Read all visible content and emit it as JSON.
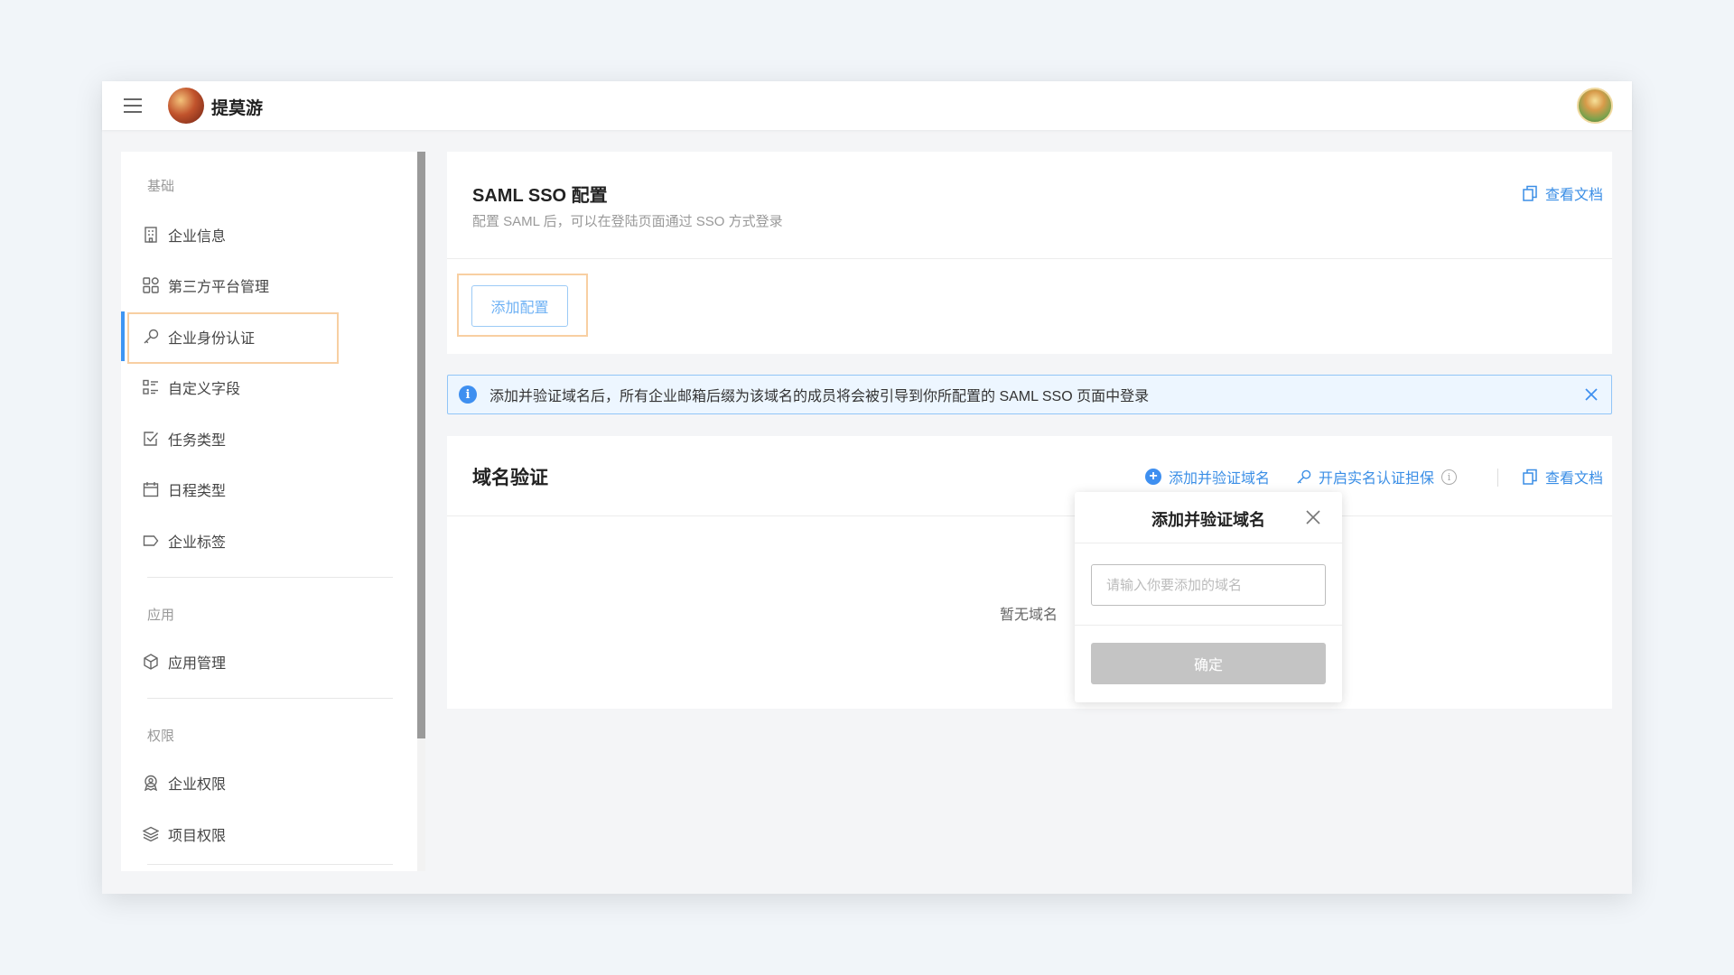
{
  "header": {
    "brand": "提莫游",
    "menu_icon": "hamburger-icon",
    "logo": "brand-logo",
    "avatar": "user-avatar"
  },
  "sidebar": {
    "groups": [
      {
        "title": "基础",
        "items": [
          {
            "label": "企业信息",
            "icon": "building-icon"
          },
          {
            "label": "第三方平台管理",
            "icon": "grid-icon"
          },
          {
            "label": "企业身份认证",
            "icon": "key-icon",
            "active": true
          },
          {
            "label": "自定义字段",
            "icon": "list-icon"
          },
          {
            "label": "任务类型",
            "icon": "checkbox-icon"
          },
          {
            "label": "日程类型",
            "icon": "calendar-icon"
          },
          {
            "label": "企业标签",
            "icon": "tag-icon"
          }
        ]
      },
      {
        "title": "应用",
        "items": [
          {
            "label": "应用管理",
            "icon": "cube-icon"
          }
        ]
      },
      {
        "title": "权限",
        "items": [
          {
            "label": "企业权限",
            "icon": "badge-icon"
          },
          {
            "label": "项目权限",
            "icon": "layers-icon"
          }
        ]
      }
    ]
  },
  "saml": {
    "title": "SAML SSO 配置",
    "subtitle": "配置 SAML 后，可以在登陆页面通过 SSO 方式登录",
    "doc_link": "查看文档",
    "add_button": "添加配置"
  },
  "alert": {
    "message": "添加并验证域名后，所有企业邮箱后缀为该域名的成员将会被引导到你所配置的 SAML SSO 页面中登录"
  },
  "domain": {
    "title": "域名验证",
    "add_verify": "添加并验证域名",
    "enable_realname": "开启实名认证担保",
    "doc_link": "查看文档",
    "empty": "暂无域名"
  },
  "popover": {
    "title": "添加并验证域名",
    "input_placeholder": "请输入你要添加的域名",
    "input_value": "",
    "confirm": "确定"
  },
  "colors": {
    "accent": "#3e95f3",
    "highlight": "#f8cfa2",
    "alert_bg": "#edf6ff"
  }
}
